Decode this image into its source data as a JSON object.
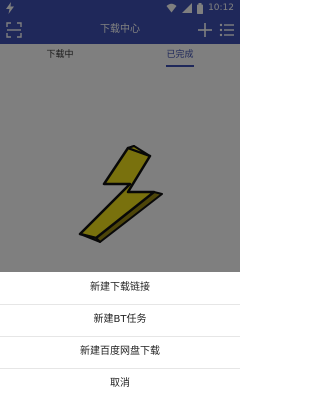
{
  "status_bar": {
    "time": "10:12",
    "icons": [
      "bolt-icon",
      "wifi-icon",
      "signal-icon",
      "battery-icon"
    ]
  },
  "app_bar": {
    "title": "下载中心",
    "icons": [
      "scan-icon",
      "add-icon",
      "list-menu-icon"
    ]
  },
  "tabs": [
    {
      "label": "下载中"
    },
    {
      "label": "已完成",
      "selected": true
    }
  ],
  "empty_state": {
    "icon": "lightning-bolt-icon"
  },
  "action_sheet": {
    "items": [
      {
        "label": "新建下载链接"
      },
      {
        "label": "新建BT任务"
      },
      {
        "label": "新建百度网盘下载"
      },
      {
        "label": "取消"
      }
    ]
  },
  "colors": {
    "primary": "#3f51b5",
    "bolt_fill": "#f2e21b",
    "bolt_shadow": "#9a8a12",
    "overlay": "rgba(0,0,0,0.5)"
  }
}
